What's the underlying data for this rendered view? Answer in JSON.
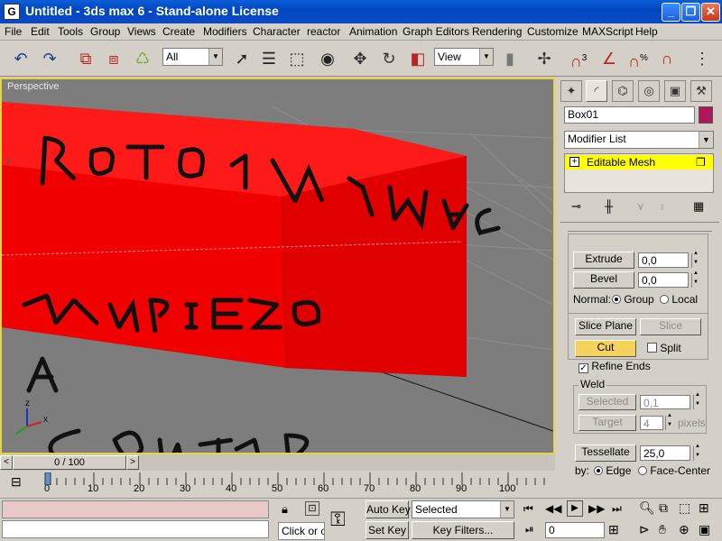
{
  "window": {
    "title": "Untitled - 3ds max 6 - Stand-alone License",
    "app_icon": "G",
    "minimize": "_",
    "maximize": "❐",
    "close": "✕"
  },
  "menu": [
    "File",
    "Edit",
    "Tools",
    "Group",
    "Views",
    "Create",
    "Modifiers",
    "Character",
    "reactor",
    "Animation",
    "Graph Editors",
    "Rendering",
    "Customize",
    "MAXScript",
    "Help"
  ],
  "toolbar": {
    "selection_filter": "All",
    "reference_coord": "View",
    "icons": [
      "undo-icon",
      "redo-icon",
      "select-link-icon",
      "unlink-icon",
      "bind-space-warp-icon",
      "select-object-icon",
      "select-by-name-icon",
      "rect-selection-icon",
      "window-crossing-icon",
      "move-icon",
      "rotate-icon",
      "scale-icon",
      "use-pivot-icon",
      "snap-3d-icon",
      "angle-snap-icon",
      "percent-snap-icon",
      "spinner-snap-icon"
    ],
    "snap_label": "3",
    "percent_label": "%"
  },
  "viewport": {
    "label": "Perspective",
    "axis": {
      "x": "x",
      "y": "y",
      "z": "z"
    },
    "scribbles": [
      "ROTO LA IMAG.",
      "Y",
      "EMPIEZO",
      "A",
      "CONTAR"
    ],
    "colors": {
      "box": "#ff0000",
      "background": "#7d7d7d",
      "border": "#e7d34a"
    }
  },
  "panel": {
    "tabs": [
      "create-tab",
      "modify-tab",
      "hierarchy-tab",
      "motion-tab",
      "display-tab",
      "utilities-tab"
    ],
    "object_name": "Box01",
    "object_color": "#b0165a",
    "modifier_list": "Modifier List",
    "stack_item": "Editable Mesh",
    "stack_expand": "+",
    "extrude_label": "Extrude",
    "extrude_value": "0,0",
    "bevel_label": "Bevel",
    "bevel_value": "0,0",
    "normal_label": "Normal:",
    "normal_group": "Group",
    "normal_local": "Local",
    "slice_plane": "Slice Plane",
    "slice": "Slice",
    "cut": "Cut",
    "split": "Split",
    "refine_ends": "Refine Ends",
    "weld_title": "Weld",
    "weld_selected": "Selected",
    "weld_selected_value": "0,1",
    "weld_target": "Target",
    "weld_target_value": "4",
    "pixels_label": "pixels",
    "tessellate": "Tessellate",
    "tessellate_value": "25,0",
    "by_label": "by:",
    "by_edge": "Edge",
    "by_face_center": "Face-Center"
  },
  "timeline": {
    "frame_indicator": "0 / 100",
    "ticks": [
      "0",
      "10",
      "20",
      "30",
      "40",
      "50",
      "60",
      "70",
      "80",
      "90",
      "100"
    ],
    "prev": "<",
    "next": ">"
  },
  "status": {
    "prompt": "Click or cl",
    "auto_key": "Auto Key",
    "set_key": "Set Key",
    "selected_dropdown": "Selected",
    "key_filters": "Key Filters...",
    "frame_value": "0"
  }
}
